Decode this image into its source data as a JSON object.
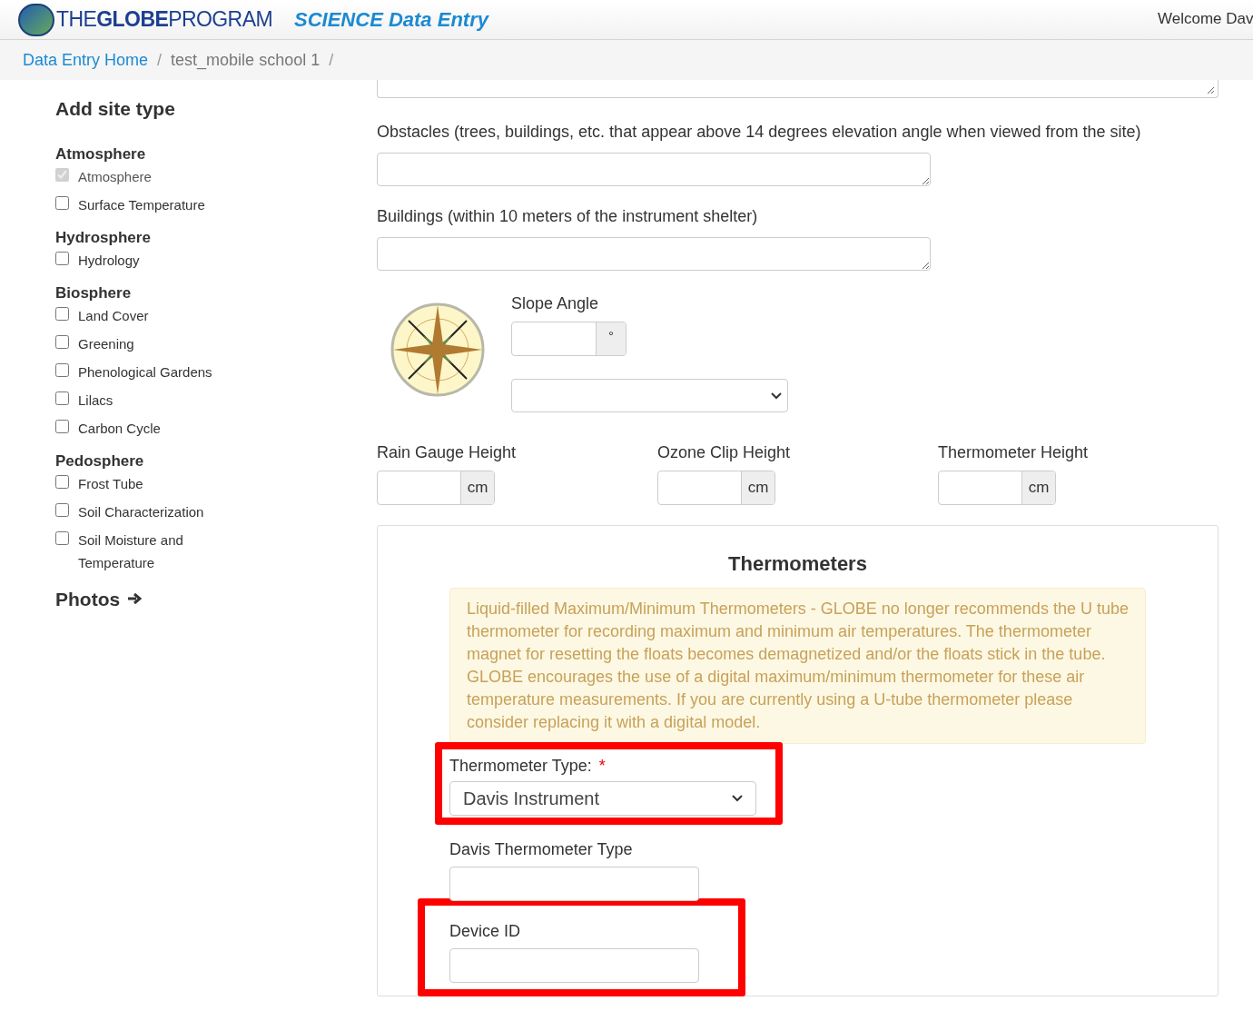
{
  "header": {
    "logo_text_1": "THE",
    "logo_text_2": "GLOBE",
    "logo_text_3": "PROGRAM",
    "app_title": "SCIENCE Data Entry",
    "welcome": "Welcome Dav"
  },
  "breadcrumbs": [
    {
      "label": "Data Entry Home",
      "link": true
    },
    {
      "label": "test_mobile school 1",
      "link": false
    }
  ],
  "breadcrumb_separator": "/",
  "sidebar": {
    "title": "Add site type",
    "groups": [
      {
        "title": "Atmosphere",
        "items": [
          {
            "label": "Atmosphere",
            "checked": true,
            "disabled": true
          },
          {
            "label": "Surface Temperature",
            "checked": false,
            "disabled": false
          }
        ]
      },
      {
        "title": "Hydrosphere",
        "items": [
          {
            "label": "Hydrology",
            "checked": false,
            "disabled": false
          }
        ]
      },
      {
        "title": "Biosphere",
        "items": [
          {
            "label": "Land Cover",
            "checked": false,
            "disabled": false
          },
          {
            "label": "Greening",
            "checked": false,
            "disabled": false
          },
          {
            "label": "Phenological Gardens",
            "checked": false,
            "disabled": false
          },
          {
            "label": "Lilacs",
            "checked": false,
            "disabled": false
          },
          {
            "label": "Carbon Cycle",
            "checked": false,
            "disabled": false
          }
        ]
      },
      {
        "title": "Pedosphere",
        "items": [
          {
            "label": "Frost Tube",
            "checked": false,
            "disabled": false
          },
          {
            "label": "Soil Characterization",
            "checked": false,
            "disabled": false
          },
          {
            "label": "Soil Moisture and Temperature",
            "checked": false,
            "disabled": false
          }
        ]
      }
    ],
    "photos_link": "Photos"
  },
  "textareas": [
    {
      "label": "Obstacles (trees, buildings, etc. that appear above 14 degrees elevation angle when viewed from the site)"
    },
    {
      "label": "Buildings (within 10 meters of the instrument shelter)"
    }
  ],
  "slope": {
    "label": "Slope Angle",
    "unit": "°"
  },
  "heights": [
    {
      "label": "Rain Gauge Height",
      "unit": "cm"
    },
    {
      "label": "Ozone Clip Height",
      "unit": "cm"
    },
    {
      "label": "Thermometer Height",
      "unit": "cm"
    }
  ],
  "thermometers": {
    "title": "Thermometers",
    "alert": "Liquid-filled Maximum/Minimum Thermometers - GLOBE no longer recommends the U tube thermometer for recording maximum and minimum air temperatures. The thermometer magnet for resetting the floats becomes demagnetized and/or the floats stick in the tube. GLOBE encourages the use of a digital maximum/minimum thermometer for these air temperature measurements. If you are currently using a U-tube thermometer please consider replacing it with a digital model.",
    "type_label": "Thermometer Type:",
    "required_mark": "*",
    "type_value": "Davis Instrument",
    "type_highlighted": true,
    "fields": [
      {
        "label": "Davis Thermometer Type",
        "highlighted": false
      },
      {
        "label": "Device ID",
        "highlighted": true
      }
    ]
  }
}
